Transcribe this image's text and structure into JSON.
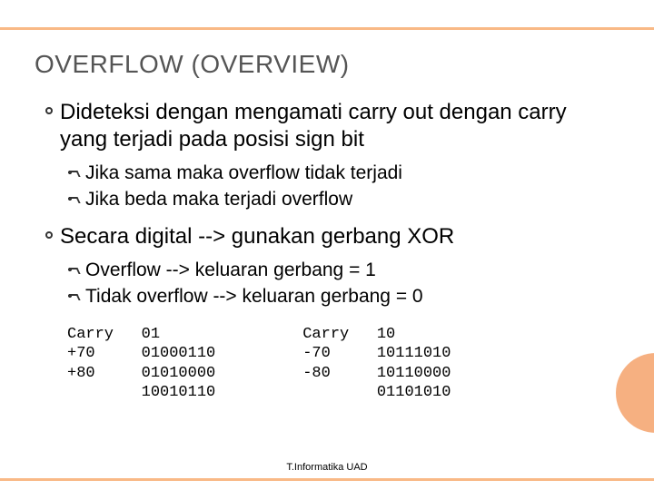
{
  "heading": "OVERFLOW (OVERVIEW)",
  "points": {
    "p1": {
      "text": "Dideteksi dengan mengamati carry out dengan carry yang terjadi pada posisi sign bit",
      "sub": {
        "s1": "Jika sama maka overflow tidak terjadi",
        "s2": "Jika beda maka terjadi overflow"
      }
    },
    "p2": {
      "text": "Secara digital --> gunakan gerbang XOR",
      "sub": {
        "s1": "Overflow --> keluaran gerbang = 1",
        "s2": "Tidak overflow --> keluaran gerbang = 0"
      }
    }
  },
  "examples": {
    "left": "Carry   01\n+70     01000110\n+80     01010000\n        10010110",
    "right": "Carry   10\n-70     10111010\n-80     10110000\n        01101010"
  },
  "footer": "T.Informatika UAD"
}
